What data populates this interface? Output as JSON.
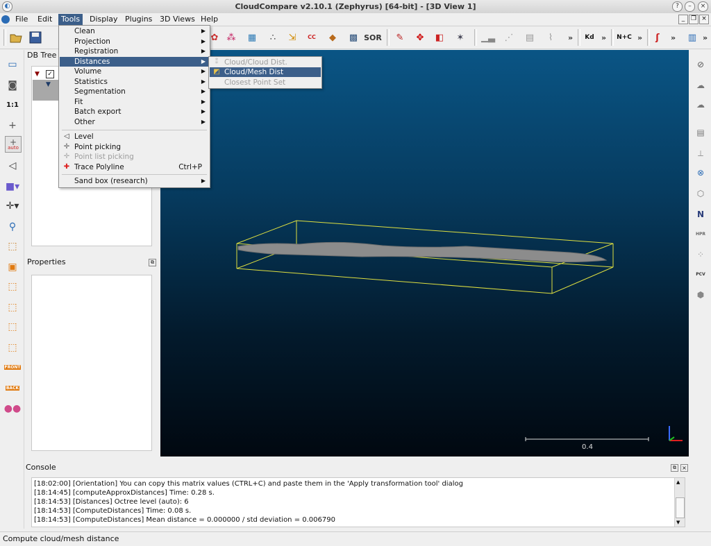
{
  "window": {
    "title": "CloudCompare v2.10.1 (Zephyrus) [64-bit] - [3D View 1]"
  },
  "menubar": {
    "items": [
      {
        "label": "File"
      },
      {
        "label": "Edit"
      },
      {
        "label": "Tools"
      },
      {
        "label": "Display"
      },
      {
        "label": "Plugins"
      },
      {
        "label": "3D Views"
      },
      {
        "label": "Help"
      }
    ]
  },
  "toolbar": {
    "cc_label": "CC",
    "sor_label": "SOR",
    "kd_label": "Kd",
    "npc_label": "N+C"
  },
  "lefttoolbar": {
    "onetoone_label": "1:1",
    "auto_label": "auto",
    "front_label": "FRONT",
    "back_label": "BACK"
  },
  "panels": {
    "dbtree_title": "DB Tree",
    "properties_title": "Properties",
    "console_title": "Console"
  },
  "tools_menu": {
    "items": [
      {
        "label": "Clean"
      },
      {
        "label": "Projection"
      },
      {
        "label": "Registration"
      },
      {
        "label": "Distances"
      },
      {
        "label": "Volume"
      },
      {
        "label": "Statistics"
      },
      {
        "label": "Segmentation"
      },
      {
        "label": "Fit"
      },
      {
        "label": "Batch export"
      },
      {
        "label": "Other"
      },
      {
        "label": "Level"
      },
      {
        "label": "Point picking"
      },
      {
        "label": "Point list picking"
      },
      {
        "label": "Trace Polyline",
        "shortcut": "Ctrl+P"
      },
      {
        "label": "Sand box (research)"
      }
    ]
  },
  "distances_submenu": {
    "items": [
      {
        "label": "Cloud/Cloud Dist."
      },
      {
        "label": "Cloud/Mesh Dist"
      },
      {
        "label": "Closest Point Set"
      }
    ]
  },
  "view3d": {
    "scale_label": "0.4"
  },
  "righttoolbar": {
    "north_label": "N",
    "hpr_label": "HPR",
    "pcv_label": "PCV"
  },
  "console": {
    "lines": [
      "[18:02:00] [Orientation] You can copy this matrix values (CTRL+C) and paste them in the 'Apply transformation tool' dialog",
      "[18:14:45] [computeApproxDistances] Time: 0.28 s.",
      "[18:14:53] [Distances] Octree level (auto): 6",
      "[18:14:53] [ComputeDistances] Time: 0.08 s.",
      "[18:14:53] [ComputeDistances] Mean distance = 0.000000 / std deviation = 0.006790"
    ]
  },
  "statusbar": {
    "text": "Compute cloud/mesh distance"
  },
  "colors": {
    "highlight": "#3c5f8a",
    "bbox": "#e0e040",
    "cloud": "#8c8c8c"
  }
}
